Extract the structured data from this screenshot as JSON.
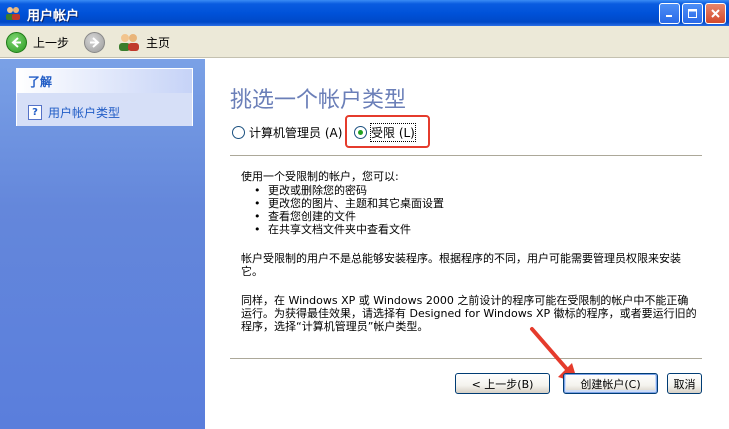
{
  "window": {
    "title": "用户帐户"
  },
  "toolbar": {
    "back_label": "上一步",
    "home_label": "主页"
  },
  "sidebar": {
    "header": "了解",
    "items": [
      {
        "label": "用户帐户类型",
        "icon": "help-icon"
      }
    ]
  },
  "main": {
    "heading": "挑选一个帐户类型",
    "options": [
      {
        "label": "计算机管理员 (A)",
        "checked": false
      },
      {
        "label": "受限 (L)",
        "checked": true
      }
    ],
    "intro": "使用一个受限制的帐户，您可以:",
    "bullets": [
      "更改或删除您的密码",
      "更改您的图片、主题和其它桌面设置",
      "查看您创建的文件",
      "在共享文档文件夹中查看文件"
    ],
    "paragraph2": "帐户受限制的用户不是总能够安装程序。根据程序的不同，用户可能需要管理员权限来安装它。",
    "paragraph3": "同样，在 Windows XP 或 Windows 2000 之前设计的程序可能在受限制的帐户中不能正确运行。为获得最佳效果，请选择有 Designed for Windows XP 徽标的程序，或者要运行旧的程序，选择“计算机管理员”帐户类型。"
  },
  "buttons": {
    "back": "< 上一步(B)",
    "create": "创建帐户(C)",
    "cancel": "取消"
  },
  "colors": {
    "titlebar": "#0052d9",
    "sidebar": "#6487db",
    "annotation": "#e53b2c"
  }
}
